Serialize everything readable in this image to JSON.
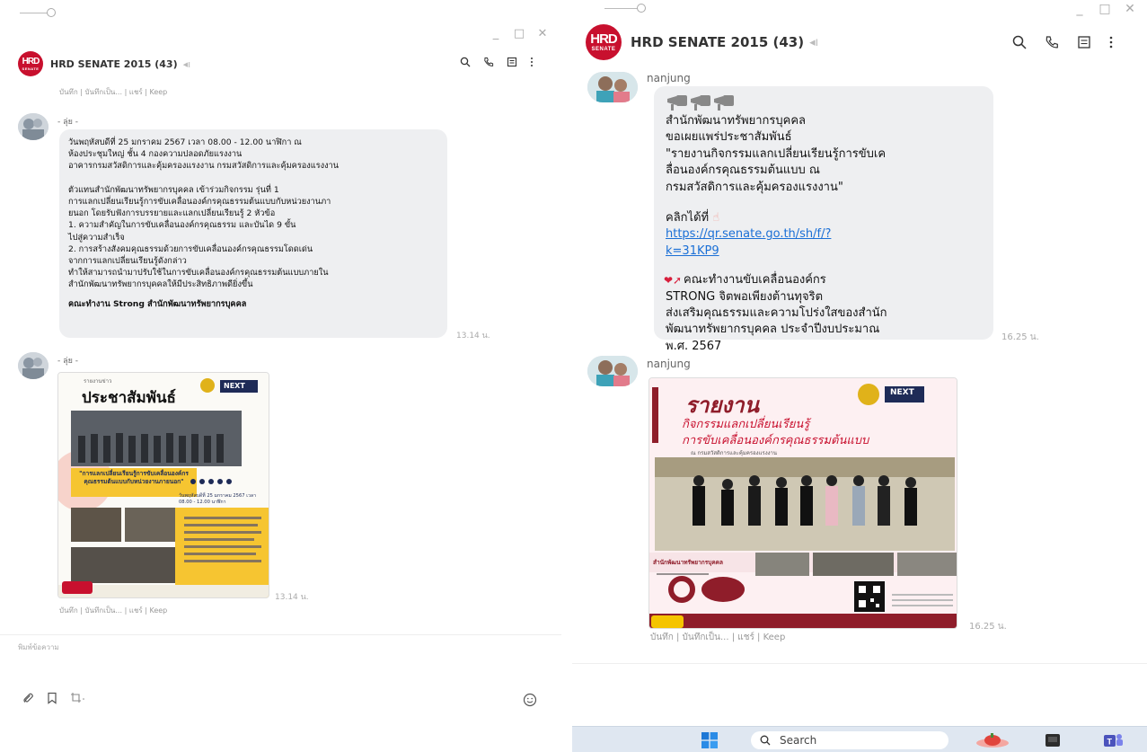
{
  "left": {
    "chat_title": "HRD SENATE 2015 (43)",
    "logo_big": "HRD",
    "logo_small": "SENATE",
    "keep_links": "บันทึก | บันทึกเป็น... | แชร์ | Keep",
    "messages": [
      {
        "sender": "- ลุ่ย -",
        "text": "วันพฤหัสบดีที่ 25 มกราคม 2567 เวลา 08.00 - 12.00 นาฬิกา ณ\nห้องประชุมใหญ่ ชั้น 4 กองความปลอดภัยแรงงาน\nอาคารกรมสวัสดิการและคุ้มครองแรงงาน กรมสวัสดิการและคุ้มครองแรงงาน\n\n      ตัวแทนสำนักพัฒนาทรัพยากรบุคคล เข้าร่วมกิจกรรม รุ่นที่ 1\nการแลกเปลี่ยนเรียนรู้การขับเคลื่อนองค์กรคุณธรรมต้นแบบกับหน่วยงานภา\nยนอก  โดยรับฟังการบรรยายและแลกเปลี่ยนเรียนรู้ 2 หัวข้อ\n 1. ความสำคัญในการขับเคลื่อนองค์กรคุณธรรม และบันได 9 ขั้น\nไปสู่ความสำเร็จ\n 2. การสร้างสังคมคุณธรรมด้วยการขับเคลื่อนองค์กรคุณธรรมโดดเด่น\n     จากการแลกเปลี่ยนเรียนรู้ดังกล่าว\nทำให้สามารถนำมาปรับใช้ในการขับเคลื่อนองค์กรคุณธรรมต้นแบบภายใน\nสำนักพัฒนาทรัพยากรบุคคลให้มีประสิทธิภาพดียิ่งขึ้น",
        "signature": "คณะทำงาน Strong สำนักพัฒนาทรัพยากรบุคคล",
        "time": "13.14 น."
      },
      {
        "sender": "- ลุ่ย -",
        "time": "13.14 น.",
        "poster": {
          "kicker": "รายงานข่าว",
          "title": "ประชาสัมพันธ์",
          "brand": "NEXT",
          "highlight": "\"การแลกเปลี่ยนเรียนรู้การขับเคลื่อนองค์กรคุณธรรมต้นแบบกับหน่วยงานภายนอก\"",
          "date": "วันพฤหัสบดีที่ 25 มกราคม 2567 เวลา 08.00 - 12.00 นาฬิกา"
        }
      }
    ],
    "input_placeholder": "พิมพ์ข้อความ"
  },
  "right": {
    "chat_title": "HRD SENATE 2015 (43)",
    "logo_big": "HRD",
    "logo_small": "SENATE",
    "messages": [
      {
        "sender": "nanjung",
        "text": "สำนักพัฒนาทรัพยากรบุคคล\nขอเผยแพร่ประชาสัมพันธ์\n\"รายงานกิจกรรมแลกเปลี่ยนเรียนรู้การขับเค\nลื่อนองค์กรคุณธรรมต้นแบบ ณ\nกรมสวัสดิการและคุ้มครองแรงงาน\"",
        "click_text": "คลิกได้ที่",
        "link": "https://qr.senate.go.th/sh/f/?k=31KP9",
        "link_line1": "https://qr.senate.go.th/sh/f/?",
        "link_line2": "k=31KP9",
        "footer": "คณะทำงานขับเคลื่อนองค์กร\nSTRONG จิตพอเพียงต้านทุจริต\nส่งเสริมคุณธรรมและความโปร่งใสของสำนัก\nพัฒนาทรัพยากรบุคคล ประจำปีงบประมาณ\nพ.ศ. 2567",
        "time": "16.25 น."
      },
      {
        "sender": "nanjung",
        "time": "16.25 น.",
        "poster": {
          "title": "รายงาน",
          "brand": "NEXT",
          "subtitle1": "กิจกรรมแลกเปลี่ยนเรียนรู้",
          "subtitle2": "การขับเคลื่อนองค์กรคุณธรรมต้นแบบ",
          "location": "ณ กรมสวัสดิการและคุ้มครองแรงงาน",
          "dept": "สำนักพัฒนาทรัพยากรบุคคล"
        }
      }
    ],
    "keep_links": "บันทึก | บันทึกเป็น... | แชร์ | Keep"
  },
  "taskbar": {
    "search_placeholder": "Search"
  },
  "colors": {
    "brand_red": "#c8102e",
    "bubble": "#eeeff1",
    "link": "#1a6fd6"
  }
}
